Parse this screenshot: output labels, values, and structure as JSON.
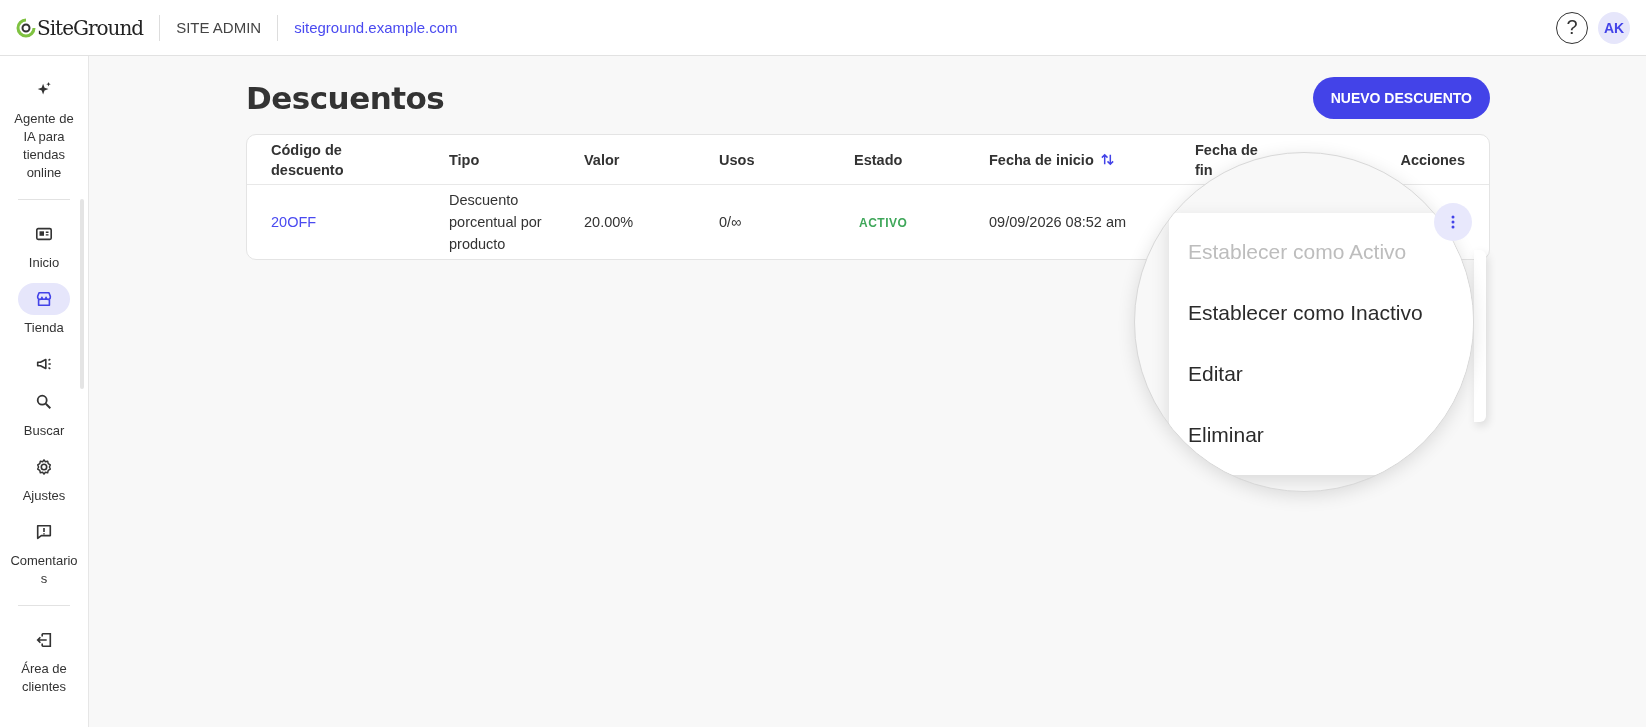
{
  "header": {
    "logo": "SiteGround",
    "section": "SITE ADMIN",
    "site": "siteground.example.com",
    "help": "?",
    "avatar": "AK"
  },
  "sidebar": {
    "items": [
      {
        "kind": "ai",
        "label": "Agente de IA para tiendas online",
        "selected": false
      },
      {
        "kind": "divider"
      },
      {
        "kind": "nav",
        "label": "Inicio",
        "selected": false
      },
      {
        "kind": "nav",
        "label": "Tienda",
        "selected": true
      },
      {
        "kind": "nav",
        "selected": false
      },
      {
        "kind": "nav",
        "label": "Buscar",
        "selected": false
      },
      {
        "kind": "nav",
        "label": "Ajustes",
        "selected": false
      },
      {
        "kind": "nav",
        "label": "Comentarios",
        "selected": false
      },
      {
        "kind": "divider"
      },
      {
        "kind": "nav",
        "label": "Área de clientes",
        "selected": false
      }
    ]
  },
  "page": {
    "title": "Descuentos",
    "new_button": "NUEVO DESCUENTO"
  },
  "table": {
    "columns": [
      {
        "label": "Código de descuento",
        "sortable": false
      },
      {
        "label": "Tipo",
        "sortable": false
      },
      {
        "label": "Valor",
        "sortable": false
      },
      {
        "label": "Usos",
        "sortable": false
      },
      {
        "label": "Estado",
        "sortable": false
      },
      {
        "label": "Fecha de inicio",
        "sortable": true
      },
      {
        "label": "Fecha de fin",
        "sortable": false
      },
      {
        "label": "Acciones",
        "sortable": false
      }
    ],
    "rows": [
      {
        "code": "20OFF",
        "type": "Descuento porcentual por producto",
        "value": "20.00%",
        "uses": "0/∞",
        "status": "ACTIVO",
        "start": "09/09/2026 08:52 am"
      }
    ]
  },
  "actions_menu": {
    "items": [
      {
        "label": "Establecer como Activo",
        "disabled": true
      },
      {
        "label": "Establecer como Inactivo",
        "disabled": false
      },
      {
        "label": "Editar",
        "disabled": false
      },
      {
        "label": "Eliminar",
        "disabled": false
      }
    ]
  }
}
